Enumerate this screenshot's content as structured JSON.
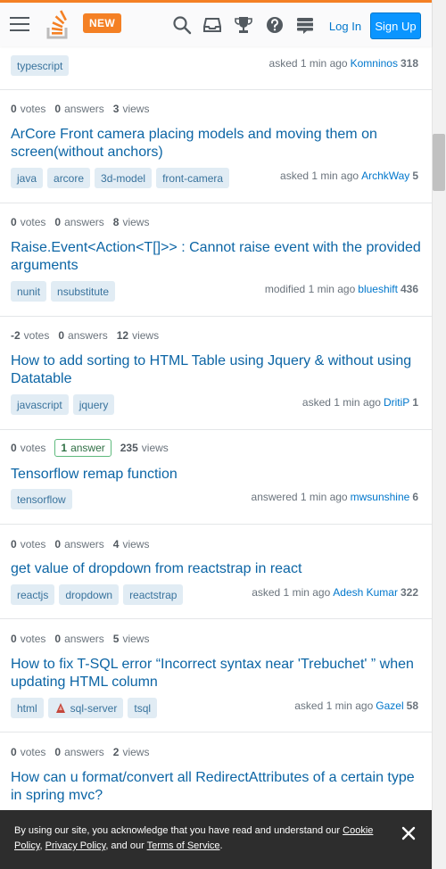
{
  "header": {
    "new_badge": "NEW",
    "login": "Log In",
    "signup": "Sign Up",
    "icons": [
      "menu-icon",
      "stackoverflow-logo",
      "search-icon",
      "inbox-icon",
      "trophy-icon",
      "help-icon",
      "stackexchange-icon"
    ],
    "accent_color": "#f48024",
    "signup_color": "#0a95ff"
  },
  "questions": [
    {
      "votes": "",
      "votes_label": "",
      "answers": "",
      "answers_label": "",
      "views": "",
      "views_label": "",
      "title": "",
      "tags": [
        "typescript"
      ],
      "action": "asked 1 min ago",
      "user": "Komninos",
      "rep": "318"
    },
    {
      "votes": "0",
      "votes_label": "votes",
      "answers": "0",
      "answers_label": "answers",
      "views": "3",
      "views_label": "views",
      "title": "ArCore Front camera placing models and moving them on screen(without anchors)",
      "tags": [
        "java",
        "arcore",
        "3d-model",
        "front-camera"
      ],
      "action": "asked 1 min ago",
      "user": "ArchkWay",
      "rep": "5"
    },
    {
      "votes": "0",
      "votes_label": "votes",
      "answers": "0",
      "answers_label": "answers",
      "views": "8",
      "views_label": "views",
      "title": "Raise.Event<Action<T[]>> : Cannot raise event with the provided arguments",
      "tags": [
        "nunit",
        "nsubstitute"
      ],
      "action": "modified 1 min ago",
      "user": "blueshift",
      "rep": "436"
    },
    {
      "votes": "-2",
      "votes_label": "votes",
      "answers": "0",
      "answers_label": "answers",
      "views": "12",
      "views_label": "views",
      "title": "How to add sorting to HTML Table using Jquery & without using Datatable",
      "tags": [
        "javascript",
        "jquery"
      ],
      "action": "asked 1 min ago",
      "user": "DritiP",
      "rep": "1"
    },
    {
      "votes": "0",
      "votes_label": "votes",
      "answers": "1",
      "answers_label": "answer",
      "views": "235",
      "views_label": "views",
      "title": "Tensorflow remap function",
      "tags": [
        "tensorflow"
      ],
      "action": "answered 1 min ago",
      "user": "mwsunshine",
      "rep": "6"
    },
    {
      "votes": "0",
      "votes_label": "votes",
      "answers": "0",
      "answers_label": "answers",
      "views": "4",
      "views_label": "views",
      "title": "get value of dropdown from reactstrap in react",
      "tags": [
        "reactjs",
        "dropdown",
        "reactstrap"
      ],
      "action": "asked 1 min ago",
      "user": "Adesh Kumar",
      "rep": "322"
    },
    {
      "votes": "0",
      "votes_label": "votes",
      "answers": "0",
      "answers_label": "answers",
      "views": "5",
      "views_label": "views",
      "title": "How to fix T-SQL error “Incorrect syntax near 'Trebuchet' ” when updating HTML column",
      "tags": [
        "html",
        "sql-server",
        "tsql"
      ],
      "action": "asked 1 min ago",
      "user": "Gazel",
      "rep": "58"
    },
    {
      "votes": "0",
      "votes_label": "votes",
      "answers": "0",
      "answers_label": "answers",
      "views": "2",
      "views_label": "views",
      "title": "How can u format/convert all RedirectAttributes of a certain type in spring mvc?",
      "tags": [],
      "action": "",
      "user": "",
      "rep": ""
    }
  ],
  "cookie": {
    "text_1": "By using our site, you acknowledge that you have read and understand our ",
    "cookie_link": "Cookie Policy",
    "sep_1": ", ",
    "privacy_link": "Privacy Policy",
    "text_2": ", and our ",
    "terms_link": "Terms of Service",
    "text_3": "."
  }
}
